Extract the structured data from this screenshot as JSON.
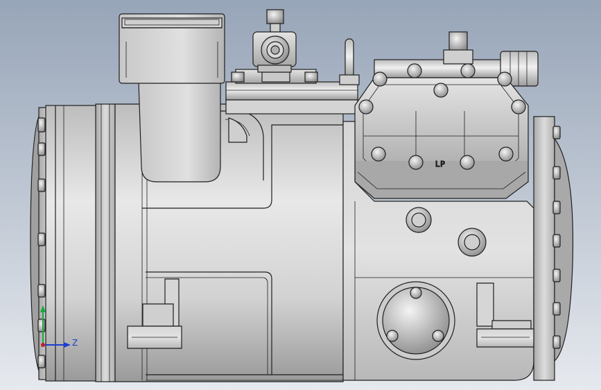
{
  "viewport": {
    "background_top": "#97a5b8",
    "background_bottom": "#e6e9ee"
  },
  "model": {
    "name_embossed": "LP",
    "body_light": "#e2e2e2",
    "body_mid": "#c4c4c4",
    "body_dark": "#8e8e8e",
    "edge": "#1e1e1e"
  },
  "triad": {
    "z_label": "Z",
    "x_color": "#1a3fd0",
    "y_color": "#1aa83a",
    "origin_color": "#c81e1e"
  }
}
